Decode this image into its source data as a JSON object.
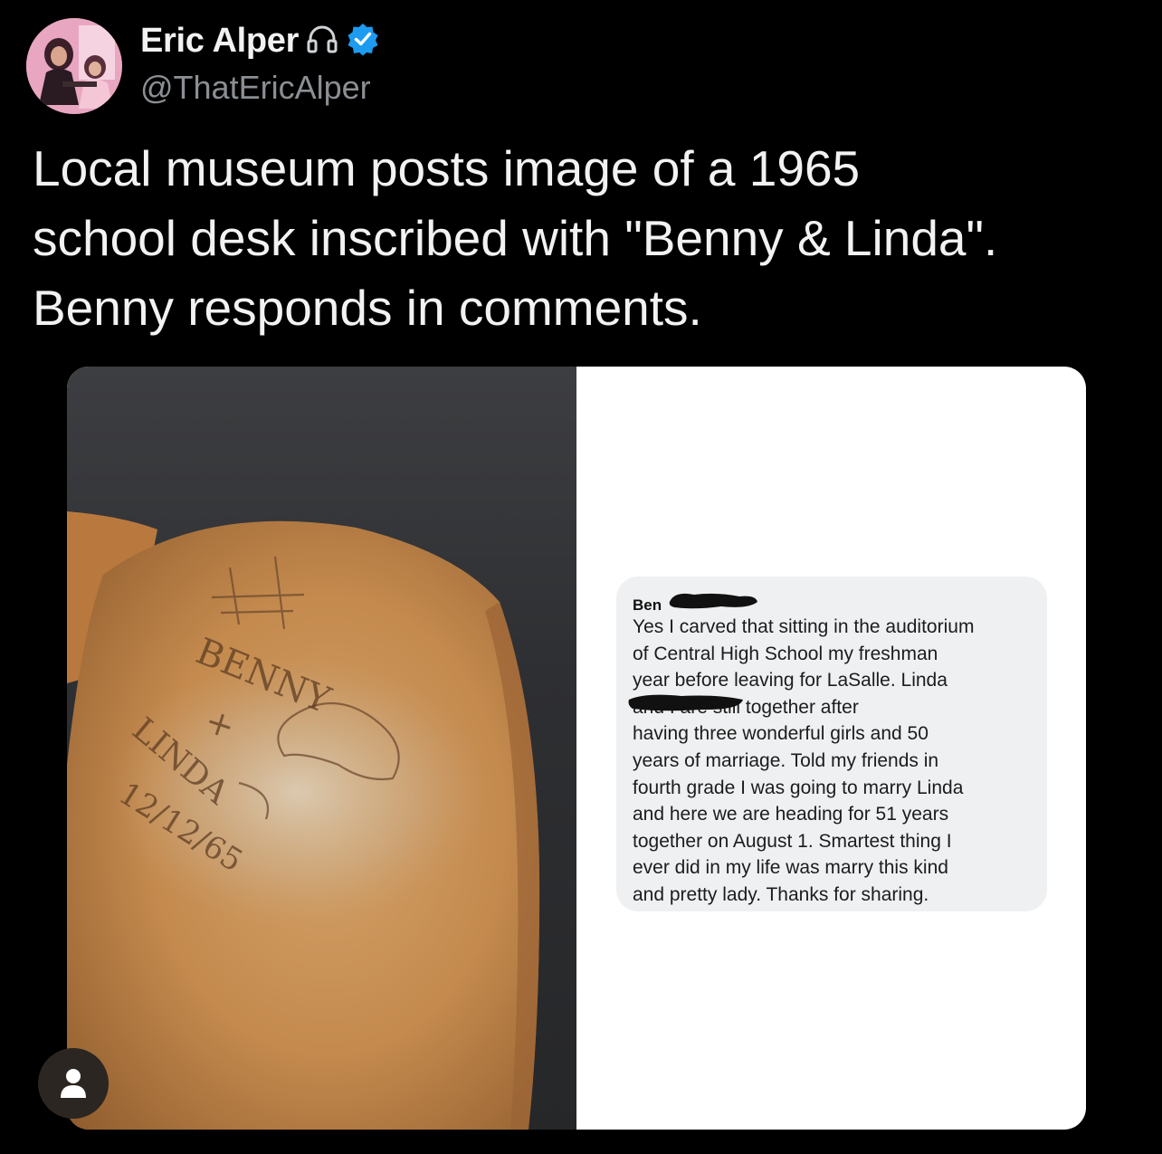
{
  "profile": {
    "display_name": "Eric Alper",
    "handle": "@ThatEricAlper",
    "icons": [
      "headphones-icon",
      "verified-badge-icon"
    ],
    "badge_color": "#1d9bf0"
  },
  "tweet": {
    "text": "Local museum posts image of a 1965\nschool desk inscribed with \"Benny & Linda\".\nBenny responds in comments."
  },
  "media": {
    "desk_carving": {
      "line1": "BENNY",
      "line2": "+",
      "line3": "LINDA",
      "date": "12/12/65"
    },
    "comment": {
      "author": "Ben",
      "body": "Yes I carved that sitting in the auditorium\nof Central High School my freshman\nyear before leaving for LaSalle. Linda\n                              and I are still together after\nhaving three wonderful girls and 50\nyears of marriage. Told my friends in\nfourth grade I was going to marry Linda\nand here we are heading for 51 years\ntogether on August 1. Smartest thing I\never did in my life was marry this kind\nand pretty lady. Thanks for sharing."
    }
  },
  "overlay": {
    "icon": "user-icon"
  }
}
